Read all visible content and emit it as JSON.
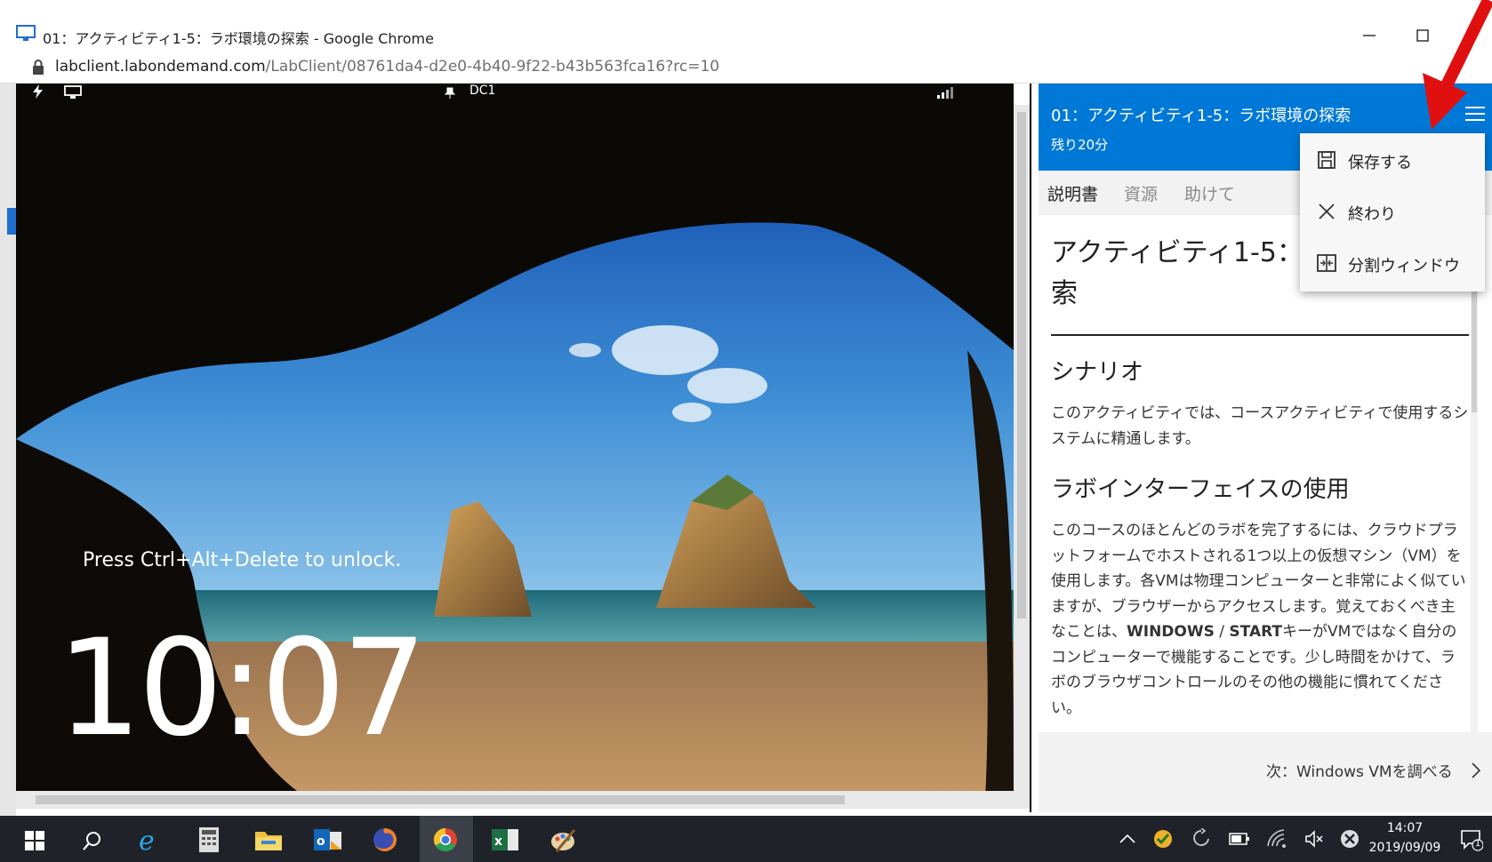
{
  "window": {
    "title": "01：アクティビティ1-5：ラボ環境の探索 - Google Chrome",
    "url_host": "labclient.labondemand.com",
    "url_path": "/LabClient/08761da4-d2e0-4b40-9f22-b43b563fca16?rc=10"
  },
  "vm": {
    "machine_name": "DC1",
    "unlock_text": "Press Ctrl+Alt+Delete to unlock.",
    "clock": "10:07"
  },
  "panel": {
    "title": "01：アクティビティ1-5：ラボ環境の探索",
    "time_left": "残り20分",
    "tabs": [
      "説明書",
      "資源",
      "助けて"
    ],
    "heading_line1": "アクティビティ1-5：",
    "heading_line2": "索",
    "scenario_heading": "シナリオ",
    "scenario_text": "このアクティビティでは、コースアクティビティで使用するシステムに精通します。",
    "interface_heading": "ラボインターフェイスの使用",
    "interface_text_1": "このコースのほとんどのラボを完了するには、クラウドプラットフォームでホストされる1つ以上の仮想マシン（VM）を使用します。各VMは物理コンピューターと非常によく似ていますが、ブラウザーからアクセスします。覚えておくべき主なことは、",
    "interface_bold_1": "WINDOWS",
    "interface_slash": " / ",
    "interface_bold_2": "START",
    "interface_text_2": "キーがVMではなく自分のコンピューターで機能することです。少し時間をかけて、ラボのブラウザコントロールのその他の機能に慣れてください。",
    "next_label": "次：Windows VMを調べる"
  },
  "menu": {
    "items": [
      {
        "label": "保存する",
        "icon": "save-icon"
      },
      {
        "label": "終わり",
        "icon": "close-icon"
      },
      {
        "label": "分割ウィンドウ",
        "icon": "split-window-icon"
      }
    ]
  },
  "taskbar": {
    "time": "14:07",
    "date": "2019/09/09",
    "notification_count": "1"
  },
  "colors": {
    "panel_accent": "#0078d7",
    "arrow": "#e01010",
    "taskbar": "#1f2329"
  }
}
